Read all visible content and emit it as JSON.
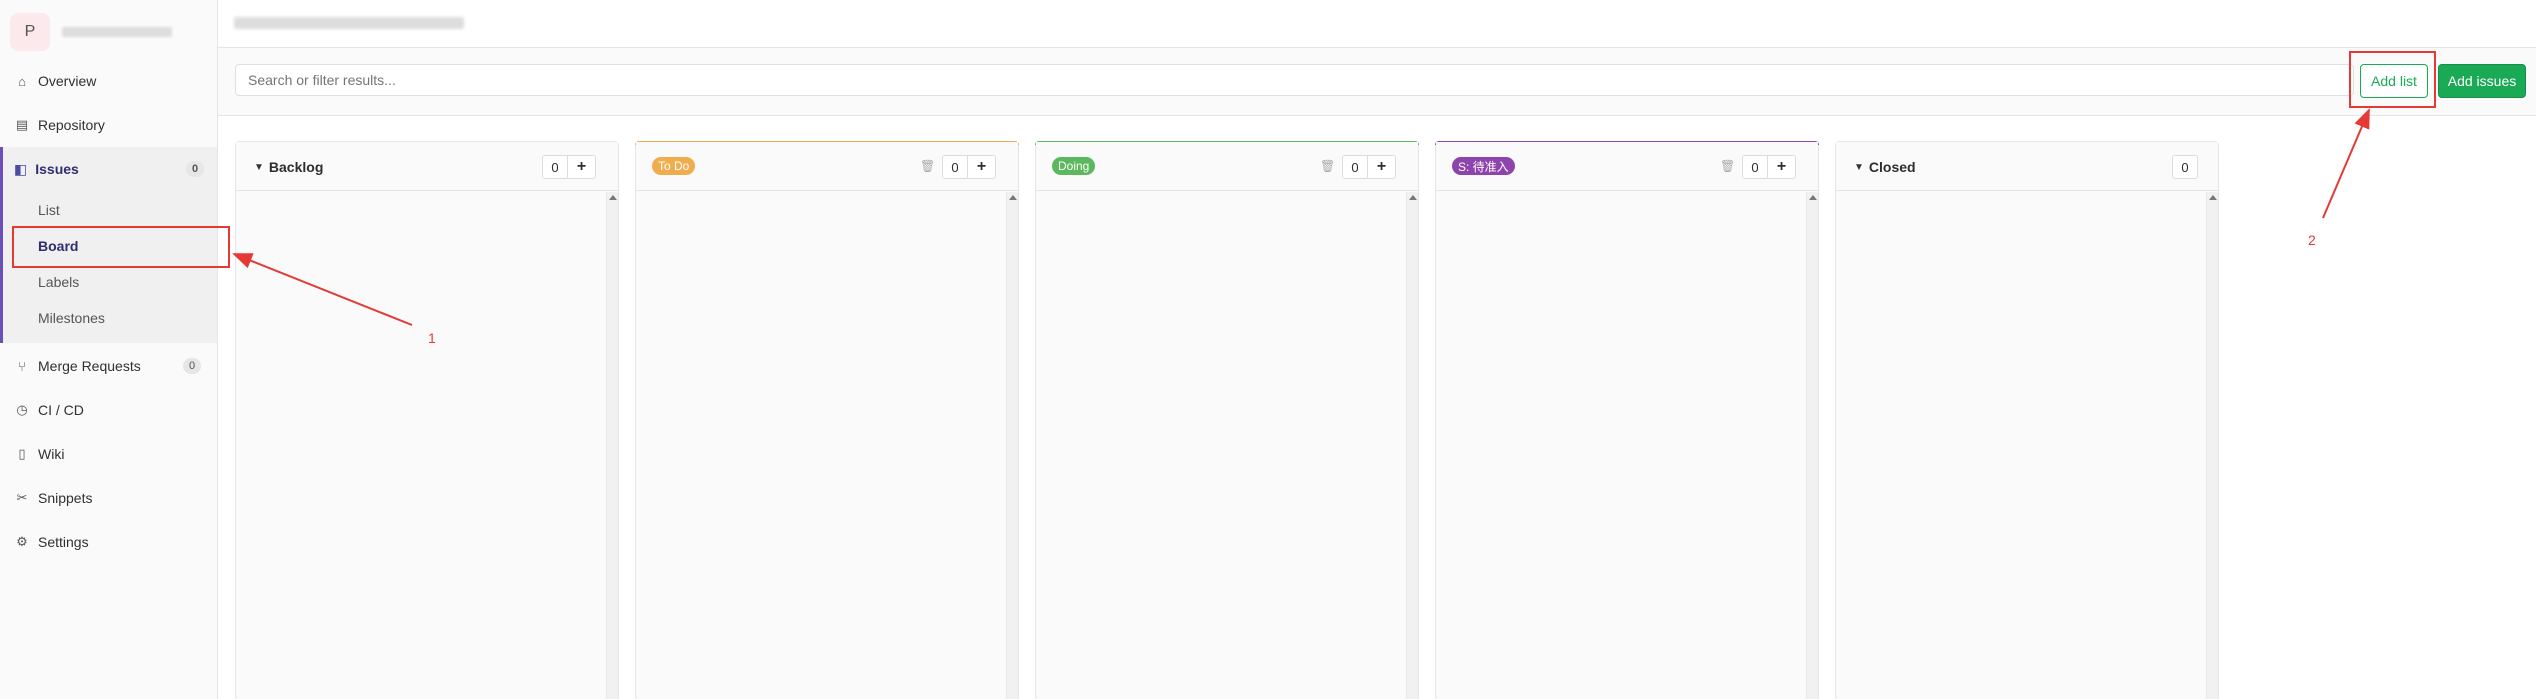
{
  "sidebar": {
    "project_initial": "P",
    "nav": {
      "overview": "Overview",
      "repository": "Repository",
      "issues": "Issues",
      "issues_count": "0",
      "merge_requests": "Merge Requests",
      "merge_requests_count": "0",
      "cicd": "CI / CD",
      "wiki": "Wiki",
      "snippets": "Snippets",
      "settings": "Settings"
    },
    "issues_sub": {
      "list": "List",
      "board": "Board",
      "labels": "Labels",
      "milestones": "Milestones"
    }
  },
  "filter": {
    "search_placeholder": "Search or filter results...",
    "add_list": "Add list",
    "add_issues": "Add issues"
  },
  "board": {
    "columns": [
      {
        "title": "Backlog",
        "count": "0",
        "kind": "plain"
      },
      {
        "title": "To Do",
        "count": "0",
        "kind": "label",
        "color": "#f0ad4e"
      },
      {
        "title": "Doing",
        "count": "0",
        "kind": "label",
        "color": "#5cb85c"
      },
      {
        "title": "S: 待准入",
        "count": "0",
        "kind": "label",
        "color": "#8e44ad"
      },
      {
        "title": "Closed",
        "count": "0",
        "kind": "plain"
      }
    ]
  },
  "annotations": {
    "label_1": "1",
    "label_2": "2",
    "color": "#e53935"
  }
}
